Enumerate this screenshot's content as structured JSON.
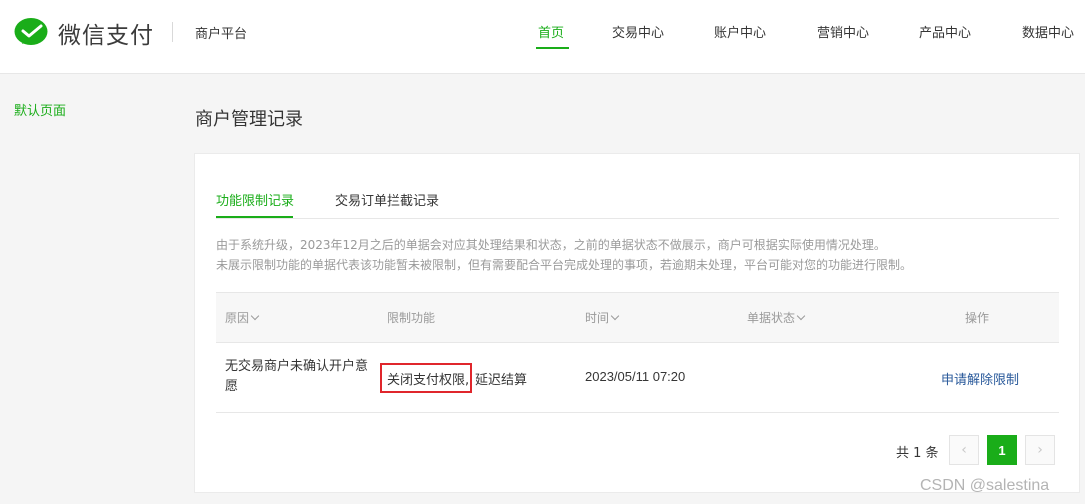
{
  "header": {
    "logo_text": "微信支付",
    "platform": "商户平台",
    "nav": [
      {
        "label": "首页",
        "active": true
      },
      {
        "label": "交易中心"
      },
      {
        "label": "账户中心"
      },
      {
        "label": "营销中心"
      },
      {
        "label": "产品中心"
      },
      {
        "label": "数据中心"
      }
    ]
  },
  "sidebar": {
    "items": [
      {
        "label": "默认页面"
      }
    ]
  },
  "page": {
    "title": "商户管理记录"
  },
  "tabs": [
    {
      "label": "功能限制记录",
      "active": true
    },
    {
      "label": "交易订单拦截记录"
    }
  ],
  "notice": [
    "由于系统升级，2023年12月之后的单据会对应其处理结果和状态，之前的单据状态不做展示，商户可根据实际使用情况处理。",
    "未展示限制功能的单据代表该功能暂未被限制，但有需要配合平台完成处理的事项，若逾期未处理，平台可能对您的功能进行限制。"
  ],
  "table": {
    "headers": [
      "原因",
      "限制功能",
      "时间",
      "单据状态",
      "操作"
    ],
    "rows": [
      {
        "reason": "无交易商户未确认开户意愿",
        "limit_primary": "关闭支付权限,",
        "limit_secondary": "延迟结算",
        "time": "2023/05/11 07:20",
        "status": "",
        "action": "申请解除限制"
      }
    ]
  },
  "pagination": {
    "total_text": "共 1 条",
    "prev": "‹",
    "current": "1",
    "next": "›"
  },
  "watermark": "CSDN @salestina",
  "colors": {
    "accent": "#1aad19",
    "link": "#2a5a9b",
    "highlight_border": "#e0262c"
  }
}
